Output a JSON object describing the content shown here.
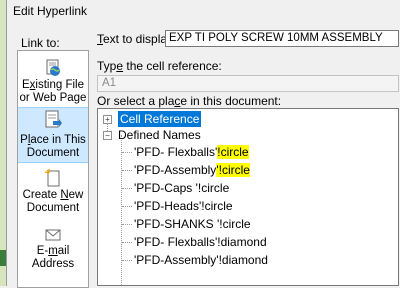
{
  "dialog": {
    "title": "Edit Hyperlink"
  },
  "link_to": {
    "label": "Link to:",
    "options": [
      {
        "line1_pre": "",
        "line1_u": "x",
        "line1_post": "isting File",
        "line1_prefix": "E",
        "line2": "or Web Page"
      },
      {
        "line1_pre": "P",
        "line1_u": "l",
        "line1_post": "ace in This",
        "line2": "Document"
      },
      {
        "line1_pre": "Create ",
        "line1_u": "N",
        "line1_post": "ew",
        "line2": "Document"
      },
      {
        "line1_pre": "E-",
        "line1_u": "m",
        "line1_post": "ail",
        "line2": "Address"
      }
    ]
  },
  "text_to_display": {
    "label_u": "T",
    "label_rest": "ext to display:",
    "value": "EXP TI POLY SCREW 10MM ASSEMBLY"
  },
  "cell_reference": {
    "label_pre": "Typ",
    "label_u": "e",
    "label_post": " the cell reference:",
    "value": "A1"
  },
  "place": {
    "label_pre": "Or select a pla",
    "label_u": "c",
    "label_post": "e in this document:",
    "tree": {
      "root1": {
        "expander": "+",
        "label": "Cell Reference"
      },
      "root2": {
        "expander": "−",
        "label": "Defined Names"
      },
      "items": [
        {
          "pre": "'PFD- Flexballs'",
          "hl": "!circle",
          "post": ""
        },
        {
          "pre": "'PFD-Assembly",
          "hl": "'!circle",
          "post": ""
        },
        {
          "pre": "'PFD-Caps '!circle",
          "hl": "",
          "post": ""
        },
        {
          "pre": "'PFD-Heads'!circle",
          "hl": "",
          "post": ""
        },
        {
          "pre": "'PFD-SHANKS '!circle",
          "hl": "",
          "post": ""
        },
        {
          "pre": "'PFD- Flexballs'!diamond",
          "hl": "",
          "post": ""
        },
        {
          "pre": "'PFD-Assembly'!diamond",
          "hl": "",
          "post": ""
        }
      ]
    }
  }
}
